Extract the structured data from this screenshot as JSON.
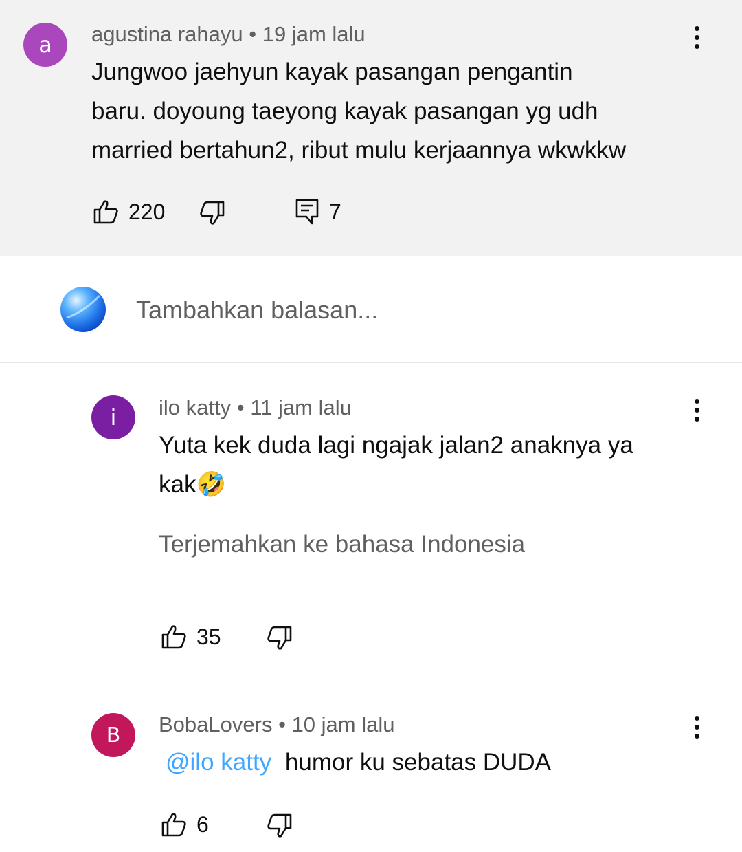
{
  "comment": {
    "avatar_letter": "a",
    "avatar_color": "#ab47bc",
    "author": "agustina rahayu",
    "time": "19 jam lalu",
    "text_lines": [
      "Jungwoo jaehyun kayak pasangan pengantin",
      "baru. doyoung taeyong kayak pasangan yg udh",
      "married bertahun2, ribut mulu kerjaannya wkwkkw"
    ],
    "likes": "220",
    "replies": "7"
  },
  "reply_box": {
    "placeholder": "Tambahkan balasan..."
  },
  "replies": [
    {
      "avatar_letter": "i",
      "avatar_color": "#7b1fa2",
      "author": "ilo katty",
      "time": "11 jam lalu",
      "text_lines": [
        "Yuta kek duda lagi ngajak jalan2 anaknya ya",
        "kak🤣"
      ],
      "translate": "Terjemahkan ke bahasa Indonesia",
      "likes": "35"
    },
    {
      "avatar_letter": "B",
      "avatar_color": "#c2185b",
      "author": "BobaLovers",
      "time": "10 jam lalu",
      "mention": "@ilo katty",
      "text": "humor ku sebatas DUDA",
      "likes": "6"
    }
  ],
  "separator": "•",
  "icons": [
    "like-icon",
    "dislike-icon",
    "reply-icon",
    "more-vert-icon"
  ],
  "colors": {
    "highlight_bg": "#f2f2f2",
    "meta_text": "#606060",
    "mention": "#3ea6ff"
  }
}
